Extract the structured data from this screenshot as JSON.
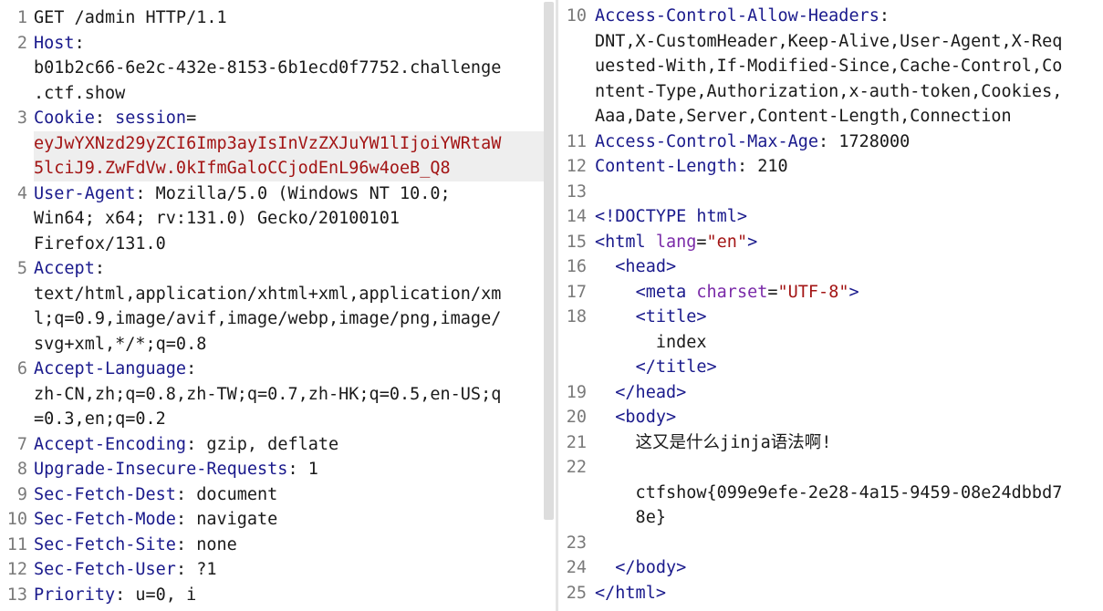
{
  "request": {
    "lines": [
      {
        "n": "1",
        "rows": [
          [
            [
              "plain",
              "GET /admin HTTP/1.1"
            ]
          ]
        ]
      },
      {
        "n": "2",
        "rows": [
          [
            [
              "key",
              "Host"
            ],
            [
              "plain",
              ":"
            ]
          ],
          [
            [
              "plain",
              "b01b2c66-6e2c-432e-8153-6b1ecd0f7752.challenge"
            ]
          ],
          [
            [
              "plain",
              ".ctf.show"
            ]
          ]
        ]
      },
      {
        "n": "3",
        "rows": [
          [
            [
              "key",
              "Cookie"
            ],
            [
              "plain",
              ": "
            ],
            [
              "kw",
              "session"
            ],
            [
              "plain",
              "="
            ]
          ],
          [
            [
              "red",
              "eyJwYXNzd29yZCI6Imp3ayIsInVzZXJuYW1lIjoiYWRtaW"
            ]
          ],
          [
            [
              "red",
              "5lciJ9.ZwFdVw.0kIfmGaloCCjodEnL96w4oeB_Q8"
            ]
          ]
        ],
        "highlight_rows": [
          1,
          2
        ]
      },
      {
        "n": "4",
        "rows": [
          [
            [
              "key",
              "User-Agent"
            ],
            [
              "plain",
              ": Mozilla/5.0 (Windows NT 10.0;"
            ]
          ],
          [
            [
              "plain",
              "Win64; x64; rv:131.0) Gecko/20100101"
            ]
          ],
          [
            [
              "plain",
              "Firefox/131.0"
            ]
          ]
        ]
      },
      {
        "n": "5",
        "rows": [
          [
            [
              "key",
              "Accept"
            ],
            [
              "plain",
              ":"
            ]
          ],
          [
            [
              "plain",
              "text/html,application/xhtml+xml,application/xm"
            ]
          ],
          [
            [
              "plain",
              "l;q=0.9,image/avif,image/webp,image/png,image/"
            ]
          ],
          [
            [
              "plain",
              "svg+xml,*/*;q=0.8"
            ]
          ]
        ]
      },
      {
        "n": "6",
        "rows": [
          [
            [
              "key",
              "Accept-Language"
            ],
            [
              "plain",
              ":"
            ]
          ],
          [
            [
              "plain",
              "zh-CN,zh;q=0.8,zh-TW;q=0.7,zh-HK;q=0.5,en-US;q"
            ]
          ],
          [
            [
              "plain",
              "=0.3,en;q=0.2"
            ]
          ]
        ]
      },
      {
        "n": "7",
        "rows": [
          [
            [
              "key",
              "Accept-Encoding"
            ],
            [
              "plain",
              ": gzip, deflate"
            ]
          ]
        ]
      },
      {
        "n": "8",
        "rows": [
          [
            [
              "key",
              "Upgrade-Insecure-Requests"
            ],
            [
              "plain",
              ": 1"
            ]
          ]
        ]
      },
      {
        "n": "9",
        "rows": [
          [
            [
              "key",
              "Sec-Fetch-Dest"
            ],
            [
              "plain",
              ": document"
            ]
          ]
        ]
      },
      {
        "n": "10",
        "rows": [
          [
            [
              "key",
              "Sec-Fetch-Mode"
            ],
            [
              "plain",
              ": navigate"
            ]
          ]
        ]
      },
      {
        "n": "11",
        "rows": [
          [
            [
              "key",
              "Sec-Fetch-Site"
            ],
            [
              "plain",
              ": none"
            ]
          ]
        ]
      },
      {
        "n": "12",
        "rows": [
          [
            [
              "key",
              "Sec-Fetch-User"
            ],
            [
              "plain",
              ": ?1"
            ]
          ]
        ]
      },
      {
        "n": "13",
        "rows": [
          [
            [
              "key",
              "Priority"
            ],
            [
              "plain",
              ": u=0, i"
            ]
          ]
        ]
      }
    ]
  },
  "response": {
    "lines": [
      {
        "n": "10",
        "rows": [
          [
            [
              "key",
              "Access-Control-Allow-Headers"
            ],
            [
              "plain",
              ":"
            ]
          ],
          [
            [
              "plain",
              "DNT,X-CustomHeader,Keep-Alive,User-Agent,X-Req"
            ]
          ],
          [
            [
              "plain",
              "uested-With,If-Modified-Since,Cache-Control,Co"
            ]
          ],
          [
            [
              "plain",
              "ntent-Type,Authorization,x-auth-token,Cookies,"
            ]
          ],
          [
            [
              "plain",
              "Aaa,Date,Server,Content-Length,Connection"
            ]
          ]
        ]
      },
      {
        "n": "11",
        "rows": [
          [
            [
              "key",
              "Access-Control-Max-Age"
            ],
            [
              "plain",
              ": 1728000"
            ]
          ]
        ]
      },
      {
        "n": "12",
        "rows": [
          [
            [
              "key",
              "Content-Length"
            ],
            [
              "plain",
              ": 210"
            ]
          ]
        ]
      },
      {
        "n": "13",
        "rows": [
          [
            [
              "plain",
              ""
            ]
          ]
        ]
      },
      {
        "n": "14",
        "rows": [
          [
            [
              "tag",
              "<!DOCTYPE html>"
            ]
          ]
        ]
      },
      {
        "n": "15",
        "rows": [
          [
            [
              "tag",
              "<html "
            ],
            [
              "attr",
              "lang"
            ],
            [
              "plain",
              "="
            ],
            [
              "str",
              "\"en\""
            ],
            [
              "tag",
              ">"
            ]
          ]
        ]
      },
      {
        "n": "16",
        "rows": [
          [
            [
              "plain",
              "  "
            ],
            [
              "tag",
              "<head>"
            ]
          ]
        ]
      },
      {
        "n": "17",
        "rows": [
          [
            [
              "plain",
              "    "
            ],
            [
              "tag",
              "<meta "
            ],
            [
              "attr",
              "charset"
            ],
            [
              "plain",
              "="
            ],
            [
              "str",
              "\"UTF-8\""
            ],
            [
              "tag",
              ">"
            ]
          ]
        ]
      },
      {
        "n": "18",
        "rows": [
          [
            [
              "plain",
              "    "
            ],
            [
              "tag",
              "<title>"
            ]
          ],
          [
            [
              "plain",
              "      index"
            ]
          ],
          [
            [
              "plain",
              "    "
            ],
            [
              "tag",
              "</title>"
            ]
          ]
        ]
      },
      {
        "n": "19",
        "rows": [
          [
            [
              "plain",
              "  "
            ],
            [
              "tag",
              "</head>"
            ]
          ]
        ]
      },
      {
        "n": "20",
        "rows": [
          [
            [
              "plain",
              "  "
            ],
            [
              "tag",
              "<body>"
            ]
          ]
        ]
      },
      {
        "n": "21",
        "rows": [
          [
            [
              "plain",
              "    这又是什么jinja语法啊!"
            ]
          ]
        ]
      },
      {
        "n": "22",
        "rows": [
          [
            [
              "plain",
              ""
            ]
          ],
          [
            [
              "plain",
              "    ctfshow{099e9efe-2e28-4a15-9459-08e24dbbd7"
            ]
          ],
          [
            [
              "plain",
              "    8e}"
            ]
          ]
        ]
      },
      {
        "n": "23",
        "rows": [
          [
            [
              "plain",
              ""
            ]
          ]
        ]
      },
      {
        "n": "24",
        "rows": [
          [
            [
              "plain",
              "  "
            ],
            [
              "tag",
              "</body>"
            ]
          ]
        ]
      },
      {
        "n": "25",
        "rows": [
          [
            [
              "tag",
              "</html>"
            ]
          ]
        ]
      }
    ]
  }
}
